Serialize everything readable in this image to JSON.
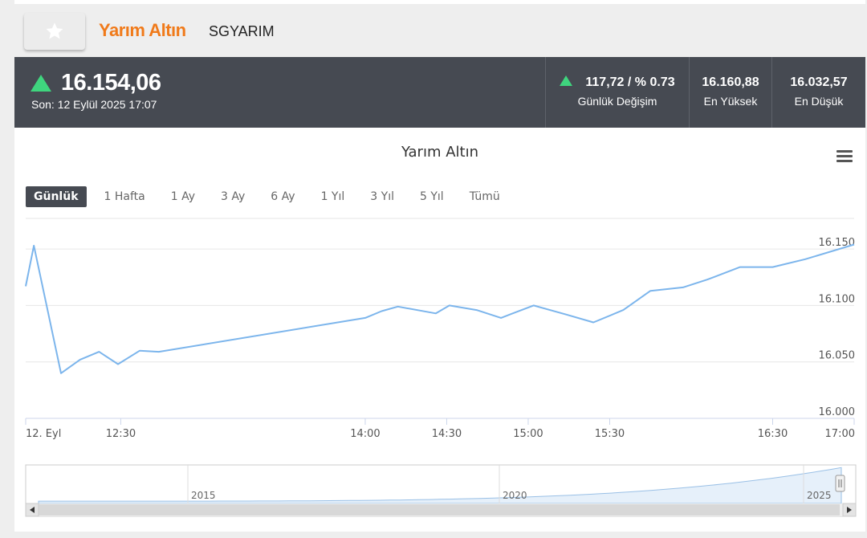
{
  "header": {
    "title": "Yarım Altın",
    "symbol": "SGYARIM",
    "favorite_icon": "star-icon"
  },
  "quote": {
    "price": "16.154,06",
    "direction": "up",
    "updated": "Son: 12 Eylül 2025 17:07",
    "change_value": "117,72 / % 0.73",
    "change_label": "Günlük Değişim",
    "high_value": "16.160,88",
    "high_label": "En Yüksek",
    "low_value": "16.032,57",
    "low_label": "En Düşük",
    "up_color": "#3fd57e",
    "bar_color": "#464a52",
    "title_color": "#f07a1a"
  },
  "chart": {
    "menu_icon": "hamburger-menu-icon",
    "ranges": [
      {
        "label": "Günlük",
        "active": true
      },
      {
        "label": "1 Hafta",
        "active": false
      },
      {
        "label": "1 Ay",
        "active": false
      },
      {
        "label": "3 Ay",
        "active": false
      },
      {
        "label": "6 Ay",
        "active": false
      },
      {
        "label": "1 Yıl",
        "active": false
      },
      {
        "label": "3 Yıl",
        "active": false
      },
      {
        "label": "5 Yıl",
        "active": false
      },
      {
        "label": "Tümü",
        "active": false
      }
    ],
    "navigator": {
      "labels": [
        "2015",
        "2020",
        "2025"
      ],
      "scroll_left_icon": "arrow-left-icon",
      "scroll_right_icon": "arrow-right-icon",
      "handle_icon": "drag-handle-icon"
    }
  },
  "chart_data": {
    "type": "line",
    "title": "Yarım Altın",
    "line_color": "#7cb5ec",
    "ylim": [
      16000,
      16175
    ],
    "y_ticks": [
      {
        "value": 16000,
        "label": "16.000"
      },
      {
        "value": 16050,
        "label": "16.050"
      },
      {
        "value": 16100,
        "label": "16.100"
      },
      {
        "value": 16150,
        "label": "16.150"
      }
    ],
    "x_ticks": [
      {
        "label": "12. Eyl",
        "t": "11:55"
      },
      {
        "label": "12:30",
        "t": "12:30"
      },
      {
        "label": "14:00",
        "t": "14:00"
      },
      {
        "label": "14:30",
        "t": "14:30"
      },
      {
        "label": "15:00",
        "t": "15:00"
      },
      {
        "label": "15:30",
        "t": "15:30"
      },
      {
        "label": "16:30",
        "t": "16:30"
      },
      {
        "label": "17:00",
        "t": "17:00"
      }
    ],
    "x_range": [
      "11:55",
      "17:00"
    ],
    "series": [
      {
        "points": [
          [
            "11:55",
            16117
          ],
          [
            "11:58",
            16153
          ],
          [
            "12:08",
            16040
          ],
          [
            "12:15",
            16052
          ],
          [
            "12:22",
            16059
          ],
          [
            "12:29",
            16048
          ],
          [
            "12:37",
            16060
          ],
          [
            "12:44",
            16059
          ],
          [
            "14:00",
            16089
          ],
          [
            "14:06",
            16095
          ],
          [
            "14:12",
            16099
          ],
          [
            "14:26",
            16093
          ],
          [
            "14:31",
            16100
          ],
          [
            "14:41",
            16096
          ],
          [
            "14:50",
            16089
          ],
          [
            "15:02",
            16100
          ],
          [
            "15:14",
            16092
          ],
          [
            "15:24",
            16085
          ],
          [
            "15:35",
            16096
          ],
          [
            "15:45",
            16113
          ],
          [
            "15:57",
            16116
          ],
          [
            "16:06",
            16123
          ],
          [
            "16:18",
            16134
          ],
          [
            "16:30",
            16134
          ],
          [
            "16:42",
            16141
          ],
          [
            "17:00",
            16154
          ]
        ]
      }
    ]
  }
}
